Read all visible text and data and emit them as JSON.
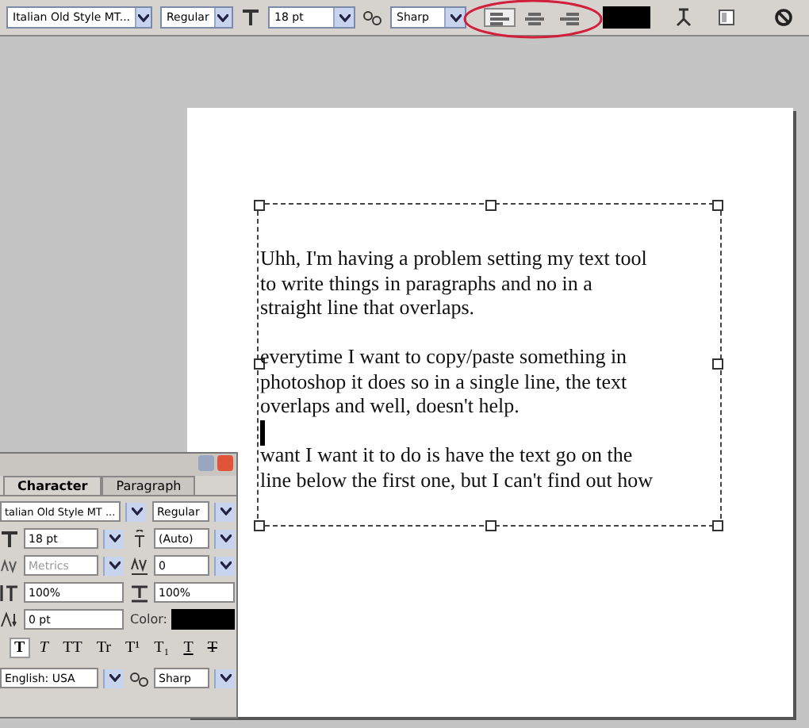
{
  "options_bar": {
    "font_family": "Italian Old Style MT...",
    "font_style": "Regular",
    "font_size": "18 pt",
    "anti_alias": "Sharp",
    "alignment": [
      {
        "kind": "left",
        "selected": true
      },
      {
        "kind": "center",
        "selected": false
      },
      {
        "kind": "right",
        "selected": false
      }
    ]
  },
  "document": {
    "paragraphs": [
      [
        "Uhh, I'm having a problem setting my text tool",
        "to write things in paragraphs and no in a",
        "straight line that overlaps."
      ],
      [
        "everytime I want to copy/paste something in",
        "photoshop it does so in a single line, the text",
        "overlaps and well, doesn't help."
      ],
      [
        "want I want it to do is have the text go on the",
        "line below the first one, but I can't find out how"
      ]
    ]
  },
  "character_panel": {
    "tabs": [
      {
        "label": "Character",
        "selected": true
      },
      {
        "label": "Paragraph",
        "selected": false
      }
    ],
    "font_family": "talian Old Style MT ...",
    "font_style": "Regular",
    "font_size": "18 pt",
    "leading": "(Auto)",
    "kerning": {
      "value": "Metrics",
      "disabled": true
    },
    "tracking": "0",
    "vertical_scale": "100%",
    "horizontal_scale": "100%",
    "baseline_shift": "0 pt",
    "color_label": "Color:",
    "styles": [
      {
        "kind": "bold",
        "glyph": "T",
        "selected": true
      },
      {
        "kind": "italic",
        "glyph": "T",
        "selected": false
      },
      {
        "kind": "caps",
        "glyph": "TT",
        "selected": false
      },
      {
        "kind": "smallcaps",
        "glyph": "Tr",
        "selected": false
      },
      {
        "kind": "super",
        "glyph": "T¹",
        "selected": false
      },
      {
        "kind": "sub",
        "glyph": "T₁",
        "selected": false
      },
      {
        "kind": "underline",
        "glyph": "T",
        "selected": false
      },
      {
        "kind": "strike",
        "glyph": "T",
        "selected": false
      }
    ],
    "language": "English: USA",
    "anti_alias": "Sharp"
  }
}
